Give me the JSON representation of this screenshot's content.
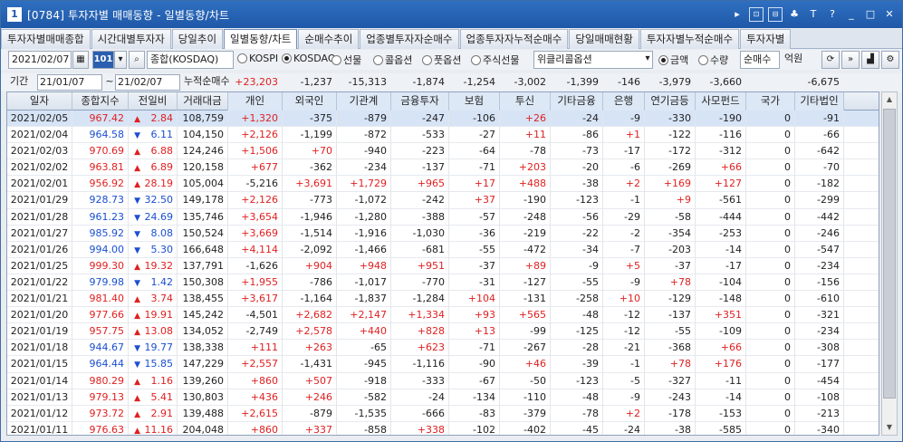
{
  "window": {
    "num": "1",
    "title": "[0784] 투자자별 매매동향 - 일별동향/차트",
    "buttons": [
      "▸",
      "⊡",
      "⊟",
      "♣",
      "T",
      "?",
      "_",
      "□",
      "✕"
    ]
  },
  "tabs": [
    "투자자별매매종합",
    "시간대별투자자",
    "당일추이",
    "일별동향/차트",
    "순매수추이",
    "업종별투자자순매수",
    "업종투자자누적순매수",
    "당일매매현황",
    "투자자별누적순매수",
    "투자자별"
  ],
  "active_tab": 3,
  "toolbar": {
    "date": "2021/02/07",
    "code_btn": "101",
    "market": "종합(KOSDAQ)",
    "radios1": [
      {
        "label": "KOSPI",
        "on": false
      },
      {
        "label": "KOSDAQ",
        "on": true
      },
      {
        "label": "선물",
        "on": false
      },
      {
        "label": "콜옵션",
        "on": false
      },
      {
        "label": "풋옵션",
        "on": false
      },
      {
        "label": "주식선물",
        "on": false
      }
    ],
    "weekly": "위클리콜옵션",
    "radios2": [
      {
        "label": "금액",
        "on": true
      },
      {
        "label": "수량",
        "on": false
      }
    ],
    "mode": "순매수",
    "unit": "억원"
  },
  "period": {
    "label": "기간",
    "from": "21/01/07",
    "to": "21/02/07",
    "cum_label": "누적순매수",
    "sums": [
      "+23,203",
      "-1,237",
      "-15,313",
      "-1,874",
      "-1,254",
      "-3,002",
      "-1,399",
      "-146",
      "-3,979",
      "-3,660",
      "",
      "-6,675"
    ]
  },
  "columns": [
    "일자",
    "종합지수",
    "전일비",
    "거래대금",
    "개인",
    "외국인",
    "기관계",
    "금융투자",
    "보험",
    "투신",
    "기타금융",
    "은행",
    "연기금등",
    "사모펀드",
    "국가",
    "기타법인"
  ],
  "rows": [
    [
      "2021/02/05",
      "967.42",
      "▲",
      "2.84",
      "108,759",
      "+1,320",
      "-375",
      "-879",
      "-247",
      "-106",
      "+26",
      "-24",
      "-9",
      "-330",
      "-190",
      "0",
      "-91"
    ],
    [
      "2021/02/04",
      "964.58",
      "▼",
      "6.11",
      "104,150",
      "+2,126",
      "-1,199",
      "-872",
      "-533",
      "-27",
      "+11",
      "-86",
      "+1",
      "-122",
      "-116",
      "0",
      "-66"
    ],
    [
      "2021/02/03",
      "970.69",
      "▲",
      "6.88",
      "124,246",
      "+1,506",
      "+70",
      "-940",
      "-223",
      "-64",
      "-78",
      "-73",
      "-17",
      "-172",
      "-312",
      "0",
      "-642"
    ],
    [
      "2021/02/02",
      "963.81",
      "▲",
      "6.89",
      "120,158",
      "+677",
      "-362",
      "-234",
      "-137",
      "-71",
      "+203",
      "-20",
      "-6",
      "-269",
      "+66",
      "0",
      "-70"
    ],
    [
      "2021/02/01",
      "956.92",
      "▲",
      "28.19",
      "105,004",
      "-5,216",
      "+3,691",
      "+1,729",
      "+965",
      "+17",
      "+488",
      "-38",
      "+2",
      "+169",
      "+127",
      "0",
      "-182"
    ],
    [
      "2021/01/29",
      "928.73",
      "▼",
      "32.50",
      "149,178",
      "+2,126",
      "-773",
      "-1,072",
      "-242",
      "+37",
      "-190",
      "-123",
      "-1",
      "+9",
      "-561",
      "0",
      "-299"
    ],
    [
      "2021/01/28",
      "961.23",
      "▼",
      "24.69",
      "135,746",
      "+3,654",
      "-1,946",
      "-1,280",
      "-388",
      "-57",
      "-248",
      "-56",
      "-29",
      "-58",
      "-444",
      "0",
      "-442"
    ],
    [
      "2021/01/27",
      "985.92",
      "▼",
      "8.08",
      "150,524",
      "+3,669",
      "-1,514",
      "-1,916",
      "-1,030",
      "-36",
      "-219",
      "-22",
      "-2",
      "-354",
      "-253",
      "0",
      "-246"
    ],
    [
      "2021/01/26",
      "994.00",
      "▼",
      "5.30",
      "166,648",
      "+4,114",
      "-2,092",
      "-1,466",
      "-681",
      "-55",
      "-472",
      "-34",
      "-7",
      "-203",
      "-14",
      "0",
      "-547"
    ],
    [
      "2021/01/25",
      "999.30",
      "▲",
      "19.32",
      "137,791",
      "-1,626",
      "+904",
      "+948",
      "+951",
      "-37",
      "+89",
      "-9",
      "+5",
      "-37",
      "-17",
      "0",
      "-234"
    ],
    [
      "2021/01/22",
      "979.98",
      "▼",
      "1.42",
      "150,308",
      "+1,955",
      "-786",
      "-1,017",
      "-770",
      "-31",
      "-127",
      "-55",
      "-9",
      "+78",
      "-104",
      "0",
      "-156"
    ],
    [
      "2021/01/21",
      "981.40",
      "▲",
      "3.74",
      "138,455",
      "+3,617",
      "-1,164",
      "-1,837",
      "-1,284",
      "+104",
      "-131",
      "-258",
      "+10",
      "-129",
      "-148",
      "0",
      "-610"
    ],
    [
      "2021/01/20",
      "977.66",
      "▲",
      "19.91",
      "145,242",
      "-4,501",
      "+2,682",
      "+2,147",
      "+1,334",
      "+93",
      "+565",
      "-48",
      "-12",
      "-137",
      "+351",
      "0",
      "-321"
    ],
    [
      "2021/01/19",
      "957.75",
      "▲",
      "13.08",
      "134,052",
      "-2,749",
      "+2,578",
      "+440",
      "+828",
      "+13",
      "-99",
      "-125",
      "-12",
      "-55",
      "-109",
      "0",
      "-234"
    ],
    [
      "2021/01/18",
      "944.67",
      "▼",
      "19.77",
      "138,338",
      "+111",
      "+263",
      "-65",
      "+623",
      "-71",
      "-267",
      "-28",
      "-21",
      "-368",
      "+66",
      "0",
      "-308"
    ],
    [
      "2021/01/15",
      "964.44",
      "▼",
      "15.85",
      "147,229",
      "+2,557",
      "-1,431",
      "-945",
      "-1,116",
      "-90",
      "+46",
      "-39",
      "-1",
      "+78",
      "+176",
      "0",
      "-177"
    ],
    [
      "2021/01/14",
      "980.29",
      "▲",
      "1.16",
      "139,260",
      "+860",
      "+507",
      "-918",
      "-333",
      "-67",
      "-50",
      "-123",
      "-5",
      "-327",
      "-11",
      "0",
      "-454"
    ],
    [
      "2021/01/13",
      "979.13",
      "▲",
      "5.41",
      "130,803",
      "+436",
      "+246",
      "-582",
      "-24",
      "-134",
      "-110",
      "-48",
      "-9",
      "-243",
      "-14",
      "0",
      "-108"
    ],
    [
      "2021/01/12",
      "973.72",
      "▲",
      "2.91",
      "139,488",
      "+2,615",
      "-879",
      "-1,535",
      "-666",
      "-83",
      "-379",
      "-78",
      "+2",
      "-178",
      "-153",
      "0",
      "-213"
    ],
    [
      "2021/01/11",
      "976.63",
      "▲",
      "11.16",
      "204,048",
      "+860",
      "+337",
      "-858",
      "+338",
      "-102",
      "-402",
      "-45",
      "-24",
      "-38",
      "-585",
      "0",
      "-340"
    ]
  ],
  "colors": {
    "up": "#e02020",
    "down": "#1a4fd0",
    "title": "#1f58a8",
    "selected_row": "#d6e4f6"
  }
}
